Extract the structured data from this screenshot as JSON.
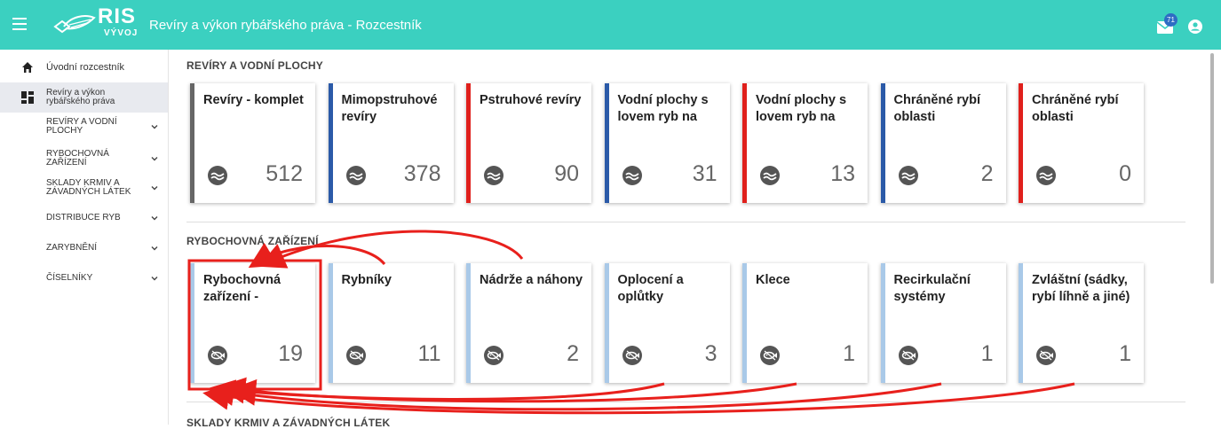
{
  "header": {
    "logo_main": "RIS",
    "logo_sub": "VÝVOJ",
    "title": "Revíry a výkon rybářského práva - Rozcestník",
    "mail_badge": "71",
    "accent": "#3bd0c0"
  },
  "sidebar": {
    "items": [
      {
        "label": "Úvodní rozcestník",
        "icon": "home-icon"
      },
      {
        "label": "Revíry a výkon rybářského práva",
        "icon": "dashboard-icon"
      },
      {
        "label": "REVÍRY A VODNÍ PLOCHY"
      },
      {
        "label": "RYBOCHOVNÁ ZAŘÍZENÍ"
      },
      {
        "label": "SKLADY KRMIV A ZÁVADNÝCH LÁTEK"
      },
      {
        "label": "DISTRIBUCE RYB"
      },
      {
        "label": "ZARYBNĚNÍ"
      },
      {
        "label": "ČÍSELNÍKY"
      }
    ]
  },
  "sections": [
    {
      "title": "REVÍRY A VODNÍ PLOCHY",
      "icon": "wave-icon",
      "cards": [
        {
          "title": "Revíry - komplet",
          "count": "512",
          "color": "#666666"
        },
        {
          "title": "Mimopstruhové revíry",
          "count": "378",
          "color": "#2b5aa8"
        },
        {
          "title": "Pstruhové revíry",
          "count": "90",
          "color": "#e0201c"
        },
        {
          "title": "Vodní plochy s lovem ryb na",
          "count": "31",
          "color": "#2b5aa8"
        },
        {
          "title": "Vodní plochy s lovem ryb na",
          "count": "13",
          "color": "#e0201c"
        },
        {
          "title": "Chráněné rybí oblasti",
          "count": "2",
          "color": "#2b5aa8"
        },
        {
          "title": "Chráněné rybí oblasti",
          "count": "0",
          "color": "#e0201c"
        }
      ]
    },
    {
      "title": "RYBOCHOVNÁ ZAŘÍZENÍ",
      "icon": "fish-icon",
      "cards": [
        {
          "title": "Rybochovná zařízení -",
          "count": "19",
          "color": "#a9c9e8"
        },
        {
          "title": "Rybníky",
          "count": "11",
          "color": "#a9c9e8"
        },
        {
          "title": "Nádrže a náhony",
          "count": "2",
          "color": "#a9c9e8"
        },
        {
          "title": "Oplocení a oplůtky",
          "count": "3",
          "color": "#a9c9e8"
        },
        {
          "title": "Klece",
          "count": "1",
          "color": "#a9c9e8"
        },
        {
          "title": "Recirkulační systémy",
          "count": "1",
          "color": "#a9c9e8"
        },
        {
          "title": "Zvláštní (sádky, rybí líhně a jiné)",
          "count": "1",
          "color": "#a9c9e8"
        }
      ]
    },
    {
      "title": "SKLADY KRMIV A ZÁVADNÝCH LÁTEK"
    }
  ],
  "annotation_color": "#e8201c"
}
